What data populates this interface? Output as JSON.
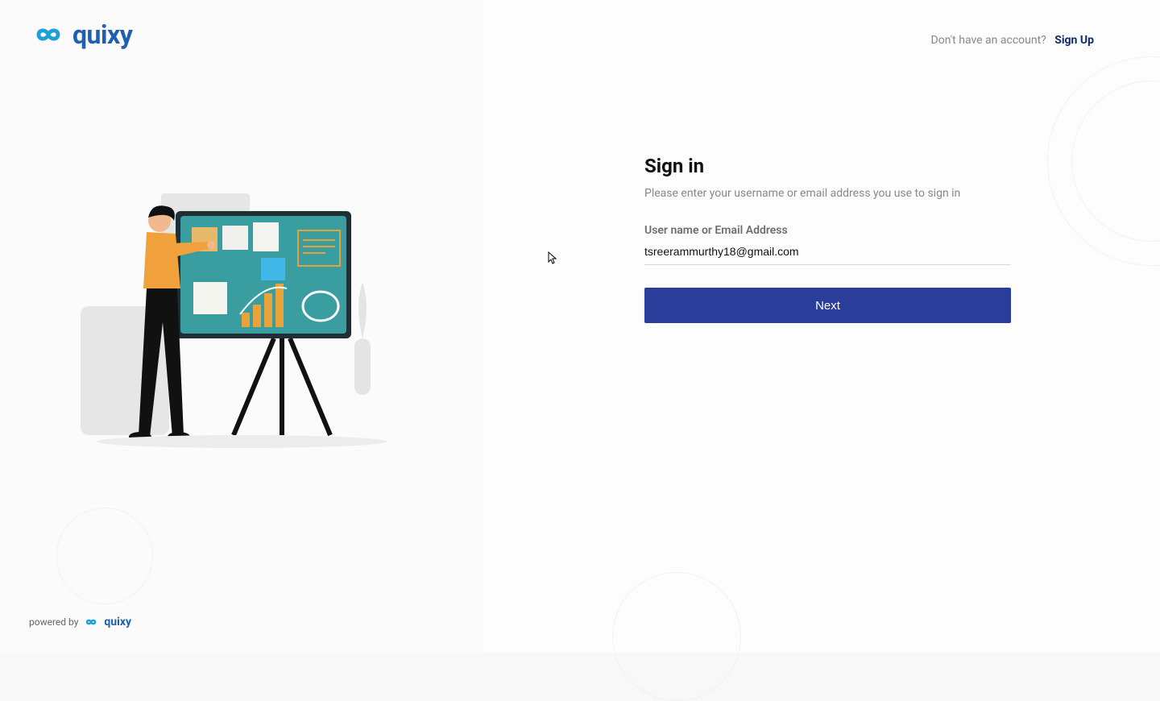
{
  "brand": {
    "name": "quixy",
    "color": "#1e5fb3"
  },
  "header": {
    "no_account_text": "Don't have an account?",
    "signup_label": "Sign Up"
  },
  "signin": {
    "title": "Sign in",
    "subtitle": "Please enter your username or email address you use to sign in",
    "username_label": "User name or Email Address",
    "username_value": "tsreerammurthy18@gmail.com",
    "next_button_label": "Next"
  },
  "footer": {
    "powered_by_label": "powered by",
    "powered_by_brand": "quixy"
  }
}
